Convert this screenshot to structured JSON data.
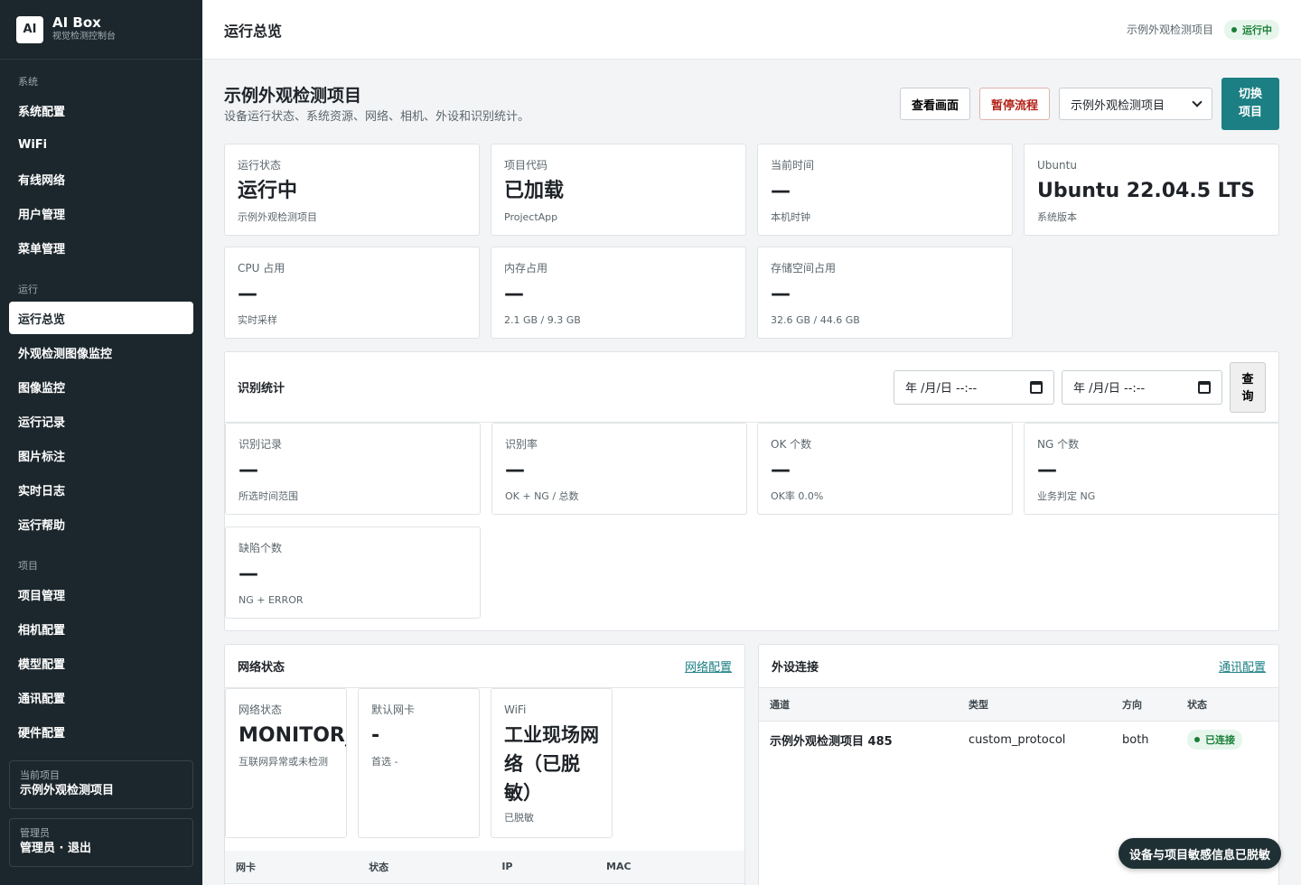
{
  "brand": {
    "logo": "AI",
    "title": "AI Box",
    "subtitle": "视觉检测控制台"
  },
  "sidebar": {
    "sections": [
      {
        "heading": "系统",
        "items": [
          "系统配置",
          "WiFi",
          "有线网络",
          "用户管理",
          "菜单管理"
        ]
      },
      {
        "heading": "运行",
        "items": [
          "运行总览",
          "外观检测图像监控",
          "图像监控",
          "运行记录",
          "图片标注",
          "实时日志",
          "运行帮助"
        ]
      },
      {
        "heading": "项目",
        "items": [
          "项目管理",
          "相机配置",
          "模型配置",
          "通讯配置",
          "硬件配置"
        ]
      }
    ],
    "active": "运行总览",
    "current_project": {
      "label": "当前项目",
      "value": "示例外观检测项目"
    },
    "admin": {
      "label": "管理员",
      "value": "管理员 · 退出"
    }
  },
  "topbar": {
    "title": "运行总览",
    "project": "示例外观检测项目",
    "status": "运行中"
  },
  "page": {
    "title": "示例外观检测项目",
    "subtitle": "设备运行状态、系统资源、网络、相机、外设和识别统计。"
  },
  "actions": {
    "view": "查看画面",
    "pause": "暂停流程",
    "select_value": "示例外观检测项目",
    "switch_line1": "切换",
    "switch_line2": "项目"
  },
  "stats_row1": [
    {
      "label": "运行状态",
      "value": "运行中",
      "sub": "示例外观检测项目"
    },
    {
      "label": "项目代码",
      "value": "已加载",
      "sub": "ProjectApp"
    },
    {
      "label": "当前时间",
      "value": "—",
      "sub": "本机时钟"
    },
    {
      "label": "Ubuntu",
      "value": "Ubuntu 22.04.5 LTS",
      "sub": "系统版本"
    }
  ],
  "stats_row2": [
    {
      "label": "CPU 占用",
      "value": "—",
      "sub": "实时采样"
    },
    {
      "label": "内存占用",
      "value": "—",
      "sub": "2.1 GB / 9.3 GB"
    },
    {
      "label": "存储空间占用",
      "value": "—",
      "sub": "32.6 GB / 44.6 GB"
    }
  ],
  "recognition": {
    "title": "识别统计",
    "date_placeholder": "年 /月/日  --:--",
    "query_line1": "查",
    "query_line2": "询",
    "cards": [
      {
        "label": "识别记录",
        "value": "—",
        "sub": "所选时间范围"
      },
      {
        "label": "识别率",
        "value": "—",
        "sub": "OK + NG / 总数"
      },
      {
        "label": "OK 个数",
        "value": "—",
        "sub": "OK率 0.0%"
      },
      {
        "label": "NG 个数",
        "value": "—",
        "sub": "业务判定 NG"
      },
      {
        "label": "缺陷个数",
        "value": "—",
        "sub": "NG + ERROR"
      }
    ]
  },
  "network": {
    "title": "网络状态",
    "link": "网络配置",
    "cards": [
      {
        "label": "网络状态",
        "value": "MONITOR_O",
        "sub": "互联网异常或未检测"
      },
      {
        "label": "默认网卡",
        "value": "-",
        "sub": "首选 -"
      },
      {
        "label": "WiFi",
        "value": "工业现场网络（已脱敏）",
        "sub": "已脱敏"
      }
    ],
    "columns": [
      "网卡",
      "状态",
      "IP",
      "MAC"
    ]
  },
  "peripheral": {
    "title": "外设连接",
    "link": "通讯配置",
    "columns": [
      "通道",
      "类型",
      "方向",
      "状态"
    ],
    "rows": [
      {
        "channel": "示例外观检测项目 485",
        "type": "custom_protocol",
        "direction": "both",
        "status": "已连接"
      }
    ]
  },
  "toast": "设备与项目敏感信息已脱敏",
  "colors": {
    "sidebar": "#1c272d",
    "accent": "#1b7f83",
    "danger": "#b42318",
    "success": "#1a7f37"
  }
}
